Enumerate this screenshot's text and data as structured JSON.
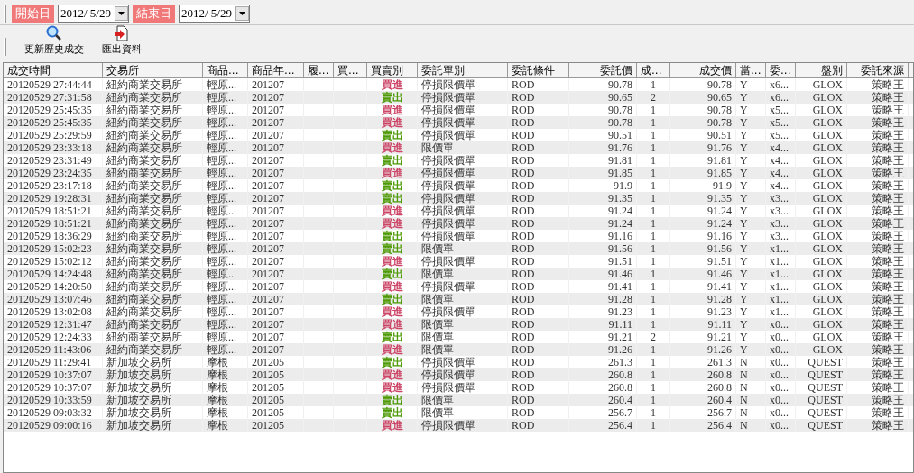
{
  "filter_bar": {
    "start_label": "開始日",
    "start_date": "2012/  5/29",
    "end_label": "結束日",
    "end_date": "2012/  5/29"
  },
  "toolbar": [
    {
      "label": "更新歷史成交",
      "kind": "search"
    },
    {
      "label": "匯出資料",
      "kind": "export"
    }
  ],
  "table": {
    "columns": [
      "成交時間",
      "交易所",
      "商品...",
      "商品年...",
      "履...",
      "買...",
      "買賣別",
      "委託單別",
      "委託條件",
      "委託價",
      "成...",
      "成交價",
      "當...",
      "委...",
      "盤別",
      "委託來源"
    ],
    "rows": [
      {
        "time": "20120529 27:44:44",
        "exchange": "紐約商業交易所",
        "product": "輕原...",
        "month": "201207",
        "side": "買進",
        "color": "#cc4466",
        "order_type": "停損限價單",
        "condition": "ROD",
        "order_price": "90.78",
        "qty": "1",
        "price": "90.78",
        "flag": "Y",
        "order_no": "x6...",
        "session": "GLOX",
        "source": "策略王"
      },
      {
        "time": "20120529 27:31:58",
        "exchange": "紐約商業交易所",
        "product": "輕原...",
        "month": "201207",
        "side": "賣出",
        "color": "#4e9a06",
        "order_type": "停損限價單",
        "condition": "ROD",
        "order_price": "90.65",
        "qty": "2",
        "price": "90.65",
        "flag": "Y",
        "order_no": "x6...",
        "session": "GLOX",
        "source": "策略王"
      },
      {
        "time": "20120529 25:45:35",
        "exchange": "紐約商業交易所",
        "product": "輕原...",
        "month": "201207",
        "side": "買進",
        "color": "#cc4466",
        "order_type": "停損限價單",
        "condition": "ROD",
        "order_price": "90.78",
        "qty": "1",
        "price": "90.78",
        "flag": "Y",
        "order_no": "x5...",
        "session": "GLOX",
        "source": "策略王"
      },
      {
        "time": "20120529 25:45:35",
        "exchange": "紐約商業交易所",
        "product": "輕原...",
        "month": "201207",
        "side": "買進",
        "color": "#cc4466",
        "order_type": "停損限價單",
        "condition": "ROD",
        "order_price": "90.78",
        "qty": "1",
        "price": "90.78",
        "flag": "Y",
        "order_no": "x5...",
        "session": "GLOX",
        "source": "策略王"
      },
      {
        "time": "20120529 25:29:59",
        "exchange": "紐約商業交易所",
        "product": "輕原...",
        "month": "201207",
        "side": "賣出",
        "color": "#4e9a06",
        "order_type": "停損限價單",
        "condition": "ROD",
        "order_price": "90.51",
        "qty": "1",
        "price": "90.51",
        "flag": "Y",
        "order_no": "x5...",
        "session": "GLOX",
        "source": "策略王"
      },
      {
        "time": "20120529 23:33:18",
        "exchange": "紐約商業交易所",
        "product": "輕原...",
        "month": "201207",
        "side": "買進",
        "color": "#cc4466",
        "order_type": "限價單",
        "condition": "ROD",
        "order_price": "91.76",
        "qty": "1",
        "price": "91.76",
        "flag": "Y",
        "order_no": "x4...",
        "session": "GLOX",
        "source": "策略王"
      },
      {
        "time": "20120529 23:31:49",
        "exchange": "紐約商業交易所",
        "product": "輕原...",
        "month": "201207",
        "side": "賣出",
        "color": "#4e9a06",
        "order_type": "停損限價單",
        "condition": "ROD",
        "order_price": "91.81",
        "qty": "1",
        "price": "91.81",
        "flag": "Y",
        "order_no": "x4...",
        "session": "GLOX",
        "source": "策略王"
      },
      {
        "time": "20120529 23:24:35",
        "exchange": "紐約商業交易所",
        "product": "輕原...",
        "month": "201207",
        "side": "買進",
        "color": "#cc4466",
        "order_type": "停損限價單",
        "condition": "ROD",
        "order_price": "91.85",
        "qty": "1",
        "price": "91.85",
        "flag": "Y",
        "order_no": "x4...",
        "session": "GLOX",
        "source": "策略王"
      },
      {
        "time": "20120529 23:17:18",
        "exchange": "紐約商業交易所",
        "product": "輕原...",
        "month": "201207",
        "side": "賣出",
        "color": "#4e9a06",
        "order_type": "停損限價單",
        "condition": "ROD",
        "order_price": "91.9",
        "qty": "1",
        "price": "91.9",
        "flag": "Y",
        "order_no": "x4...",
        "session": "GLOX",
        "source": "策略王"
      },
      {
        "time": "20120529 19:28:31",
        "exchange": "紐約商業交易所",
        "product": "輕原...",
        "month": "201207",
        "side": "賣出",
        "color": "#4e9a06",
        "order_type": "停損限價單",
        "condition": "ROD",
        "order_price": "91.35",
        "qty": "1",
        "price": "91.35",
        "flag": "Y",
        "order_no": "x3...",
        "session": "GLOX",
        "source": "策略王"
      },
      {
        "time": "20120529 18:51:21",
        "exchange": "紐約商業交易所",
        "product": "輕原...",
        "month": "201207",
        "side": "買進",
        "color": "#cc4466",
        "order_type": "停損限價單",
        "condition": "ROD",
        "order_price": "91.24",
        "qty": "1",
        "price": "91.24",
        "flag": "Y",
        "order_no": "x3...",
        "session": "GLOX",
        "source": "策略王"
      },
      {
        "time": "20120529 18:51:21",
        "exchange": "紐約商業交易所",
        "product": "輕原...",
        "month": "201207",
        "side": "買進",
        "color": "#cc4466",
        "order_type": "停損限價單",
        "condition": "ROD",
        "order_price": "91.24",
        "qty": "1",
        "price": "91.24",
        "flag": "Y",
        "order_no": "x3...",
        "session": "GLOX",
        "source": "策略王"
      },
      {
        "time": "20120529 18:36:29",
        "exchange": "紐約商業交易所",
        "product": "輕原...",
        "month": "201207",
        "side": "賣出",
        "color": "#4e9a06",
        "order_type": "停損限價單",
        "condition": "ROD",
        "order_price": "91.16",
        "qty": "1",
        "price": "91.16",
        "flag": "Y",
        "order_no": "x3...",
        "session": "GLOX",
        "source": "策略王"
      },
      {
        "time": "20120529 15:02:23",
        "exchange": "紐約商業交易所",
        "product": "輕原...",
        "month": "201207",
        "side": "賣出",
        "color": "#4e9a06",
        "order_type": "限價單",
        "condition": "ROD",
        "order_price": "91.56",
        "qty": "1",
        "price": "91.56",
        "flag": "Y",
        "order_no": "x1...",
        "session": "GLOX",
        "source": "策略王"
      },
      {
        "time": "20120529 15:02:12",
        "exchange": "紐約商業交易所",
        "product": "輕原...",
        "month": "201207",
        "side": "買進",
        "color": "#cc4466",
        "order_type": "停損限價單",
        "condition": "ROD",
        "order_price": "91.51",
        "qty": "1",
        "price": "91.51",
        "flag": "Y",
        "order_no": "x1...",
        "session": "GLOX",
        "source": "策略王"
      },
      {
        "time": "20120529 14:24:48",
        "exchange": "紐約商業交易所",
        "product": "輕原...",
        "month": "201207",
        "side": "賣出",
        "color": "#4e9a06",
        "order_type": "限價單",
        "condition": "ROD",
        "order_price": "91.46",
        "qty": "1",
        "price": "91.46",
        "flag": "Y",
        "order_no": "x1...",
        "session": "GLOX",
        "source": "策略王"
      },
      {
        "time": "20120529 14:20:50",
        "exchange": "紐約商業交易所",
        "product": "輕原...",
        "month": "201207",
        "side": "買進",
        "color": "#cc4466",
        "order_type": "停損限價單",
        "condition": "ROD",
        "order_price": "91.41",
        "qty": "1",
        "price": "91.41",
        "flag": "Y",
        "order_no": "x1...",
        "session": "GLOX",
        "source": "策略王"
      },
      {
        "time": "20120529 13:07:46",
        "exchange": "紐約商業交易所",
        "product": "輕原...",
        "month": "201207",
        "side": "賣出",
        "color": "#4e9a06",
        "order_type": "限價單",
        "condition": "ROD",
        "order_price": "91.28",
        "qty": "1",
        "price": "91.28",
        "flag": "Y",
        "order_no": "x1...",
        "session": "GLOX",
        "source": "策略王"
      },
      {
        "time": "20120529 13:02:08",
        "exchange": "紐約商業交易所",
        "product": "輕原...",
        "month": "201207",
        "side": "買進",
        "color": "#cc4466",
        "order_type": "停損限價單",
        "condition": "ROD",
        "order_price": "91.23",
        "qty": "1",
        "price": "91.23",
        "flag": "Y",
        "order_no": "x1...",
        "session": "GLOX",
        "source": "策略王"
      },
      {
        "time": "20120529 12:31:47",
        "exchange": "紐約商業交易所",
        "product": "輕原...",
        "month": "201207",
        "side": "買進",
        "color": "#cc4466",
        "order_type": "限價單",
        "condition": "ROD",
        "order_price": "91.11",
        "qty": "1",
        "price": "91.11",
        "flag": "Y",
        "order_no": "x0...",
        "session": "GLOX",
        "source": "策略王"
      },
      {
        "time": "20120529 12:24:33",
        "exchange": "紐約商業交易所",
        "product": "輕原...",
        "month": "201207",
        "side": "賣出",
        "color": "#4e9a06",
        "order_type": "限價單",
        "condition": "ROD",
        "order_price": "91.21",
        "qty": "2",
        "price": "91.21",
        "flag": "Y",
        "order_no": "x0...",
        "session": "GLOX",
        "source": "策略王"
      },
      {
        "time": "20120529 11:43:06",
        "exchange": "紐約商業交易所",
        "product": "輕原...",
        "month": "201207",
        "side": "買進",
        "color": "#cc4466",
        "order_type": "限價單",
        "condition": "ROD",
        "order_price": "91.26",
        "qty": "1",
        "price": "91.26",
        "flag": "Y",
        "order_no": "x0...",
        "session": "GLOX",
        "source": "策略王"
      },
      {
        "time": "20120529 11:29:41",
        "exchange": "新加坡交易所",
        "product": "摩根",
        "month": "201205",
        "side": "賣出",
        "color": "#4e9a06",
        "order_type": "停損限價單",
        "condition": "ROD",
        "order_price": "261.3",
        "qty": "1",
        "price": "261.3",
        "flag": "N",
        "order_no": "x0...",
        "session": "QUEST",
        "source": "策略王"
      },
      {
        "time": "20120529 10:37:07",
        "exchange": "新加坡交易所",
        "product": "摩根",
        "month": "201205",
        "side": "買進",
        "color": "#cc4466",
        "order_type": "停損限價單",
        "condition": "ROD",
        "order_price": "260.8",
        "qty": "1",
        "price": "260.8",
        "flag": "N",
        "order_no": "x0...",
        "session": "QUEST",
        "source": "策略王"
      },
      {
        "time": "20120529 10:37:07",
        "exchange": "新加坡交易所",
        "product": "摩根",
        "month": "201205",
        "side": "買進",
        "color": "#cc4466",
        "order_type": "停損限價單",
        "condition": "ROD",
        "order_price": "260.8",
        "qty": "1",
        "price": "260.8",
        "flag": "N",
        "order_no": "x0...",
        "session": "QUEST",
        "source": "策略王"
      },
      {
        "time": "20120529 10:33:59",
        "exchange": "新加坡交易所",
        "product": "摩根",
        "month": "201205",
        "side": "賣出",
        "color": "#4e9a06",
        "order_type": "限價單",
        "condition": "ROD",
        "order_price": "260.4",
        "qty": "1",
        "price": "260.4",
        "flag": "N",
        "order_no": "x0...",
        "session": "QUEST",
        "source": "策略王"
      },
      {
        "time": "20120529 09:03:32",
        "exchange": "新加坡交易所",
        "product": "摩根",
        "month": "201205",
        "side": "賣出",
        "color": "#4e9a06",
        "order_type": "限價單",
        "condition": "ROD",
        "order_price": "256.7",
        "qty": "1",
        "price": "256.7",
        "flag": "N",
        "order_no": "x0...",
        "session": "QUEST",
        "source": "策略王"
      },
      {
        "time": "20120529 09:00:16",
        "exchange": "新加坡交易所",
        "product": "摩根",
        "month": "201205",
        "side": "買進",
        "color": "#cc4466",
        "order_type": "停損限價單",
        "condition": "ROD",
        "order_price": "256.4",
        "qty": "1",
        "price": "256.4",
        "flag": "N",
        "order_no": "x0...",
        "session": "QUEST",
        "source": "策略王"
      }
    ]
  }
}
